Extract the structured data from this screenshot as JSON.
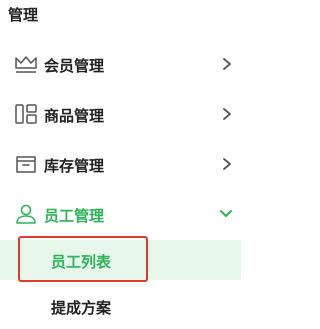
{
  "menu": {
    "title": "管理",
    "items": [
      {
        "label": "会员管理",
        "icon": "crown-icon",
        "expanded": false
      },
      {
        "label": "商品管理",
        "icon": "goods-icon",
        "expanded": false
      },
      {
        "label": "库存管理",
        "icon": "inventory-icon",
        "expanded": false
      },
      {
        "label": "员工管理",
        "icon": "staff-icon",
        "expanded": true
      }
    ],
    "staff_submenu": [
      {
        "label": "员工列表",
        "selected": true
      },
      {
        "label": "提成方案",
        "selected": false
      }
    ]
  },
  "colors": {
    "accent": "#2db45a",
    "selected_bg": "#e8f7ec",
    "highlight_border": "#e0392e",
    "text": "#222222",
    "icon": "#555555"
  }
}
